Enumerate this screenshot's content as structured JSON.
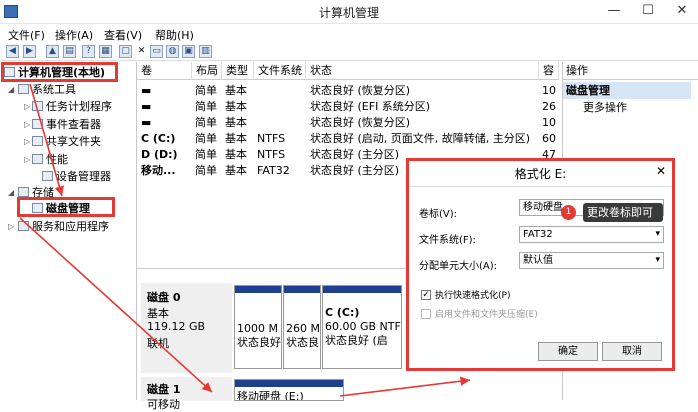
{
  "window": {
    "title": "计算机管理"
  },
  "menu": [
    "文件(F)",
    "操作(A)",
    "查看(V)",
    "帮助(H)"
  ],
  "toolbar_icons": [
    "back-icon",
    "forward-icon",
    "up-icon",
    "console-icon",
    "help-icon",
    "properties-icon",
    "delete-icon",
    "open-icon",
    "save-icon",
    "export-icon"
  ],
  "tree": {
    "root": "计算机管理(本地)",
    "system_tools": "系统工具",
    "task_scheduler": "任务计划程序",
    "event_viewer": "事件查看器",
    "shared_folders": "共享文件夹",
    "performance": "性能",
    "device_manager": "设备管理器",
    "storage": "存储",
    "disk_management": "磁盘管理",
    "services": "服务和应用程序"
  },
  "volume_table": {
    "headers": [
      "卷",
      "布局",
      "类型",
      "文件系统",
      "状态",
      "容"
    ],
    "rows": [
      {
        "vol": "",
        "layout": "简单",
        "type": "基本",
        "fs": "",
        "status": "状态良好 (恢复分区)",
        "cap": "10"
      },
      {
        "vol": "",
        "layout": "简单",
        "type": "基本",
        "fs": "",
        "status": "状态良好 (EFI 系统分区)",
        "cap": "26"
      },
      {
        "vol": "",
        "layout": "简单",
        "type": "基本",
        "fs": "",
        "status": "状态良好 (恢复分区)",
        "cap": "10"
      },
      {
        "vol": "C (C:)",
        "layout": "简单",
        "type": "基本",
        "fs": "NTFS",
        "status": "状态良好 (启动, 页面文件, 故障转储, 主分区)",
        "cap": "60"
      },
      {
        "vol": "D (D:)",
        "layout": "简单",
        "type": "基本",
        "fs": "NTFS",
        "status": "状态良好 (主分区)",
        "cap": "47"
      },
      {
        "vol": "移动...",
        "layout": "简单",
        "type": "基本",
        "fs": "FAT32",
        "status": "状态良好 (主分区)",
        "cap": "3."
      }
    ]
  },
  "actions": {
    "header": "操作",
    "selected": "磁盘管理",
    "more": "更多操作"
  },
  "disks": [
    {
      "name": "磁盘 0",
      "line2": "基本",
      "line3": "119.12 GB",
      "line4": "联机",
      "parts": [
        {
          "l1": "1000 M",
          "l2": "状态良好"
        },
        {
          "l1": "260 M",
          "l2": "状态良"
        },
        {
          "l1": "C (C:)",
          "l2": "60.00 GB NTFS",
          "l3": "状态良好 (启"
        }
      ]
    },
    {
      "name": "磁盘 1",
      "line2": "可移动",
      "parts": [
        {
          "l1": "移动硬盘 (E:)"
        }
      ]
    }
  ],
  "dialog": {
    "title": "格式化 E:",
    "close": "✕",
    "label_volume": "卷标(V):",
    "volume_value": "移动硬盘",
    "label_fs": "文件系统(F):",
    "fs_value": "FAT32",
    "label_alloc": "分配单元大小(A):",
    "alloc_value": "默认值",
    "quick_format": "执行快速格式化(P)",
    "compression": "启用文件和文件夹压缩(E)",
    "ok": "确定",
    "cancel": "取消"
  },
  "callout": {
    "badge": "1",
    "text": "更改卷标即可"
  }
}
